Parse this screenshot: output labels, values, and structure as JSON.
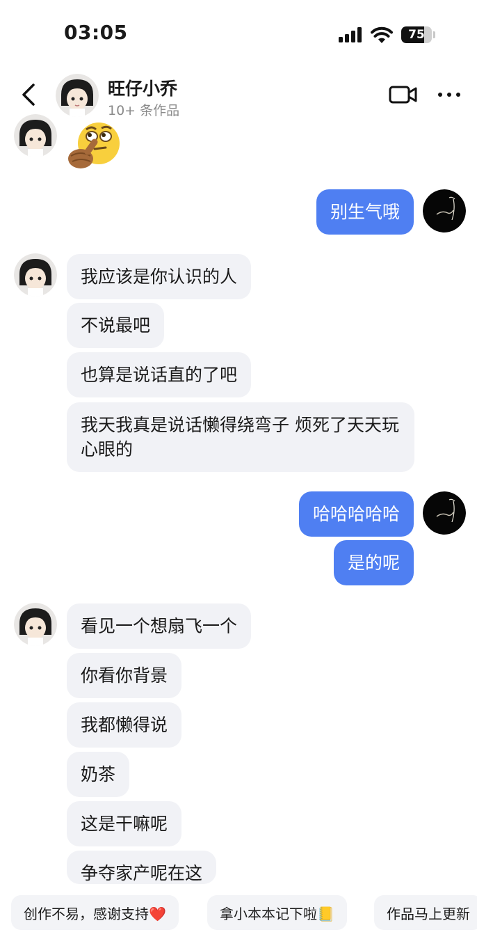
{
  "status_bar": {
    "time": "03:05",
    "battery": "75",
    "battery_level": 0.75
  },
  "header": {
    "title": "旺仔小乔",
    "subtitle": "10+ 条作品"
  },
  "messages": {
    "out_1": "别生气哦",
    "in_1": "我应该是你认识的人",
    "in_2": "不说最吧",
    "in_3": "也算是说话直的了吧",
    "in_4": "我天我真是说话懒得绕弯子 烦死了天天玩心眼的",
    "out_2": "哈哈哈哈哈",
    "out_3": "是的呢",
    "in_5": "看见一个想扇飞一个",
    "in_6": "你看你背景",
    "in_7": "我都懒得说",
    "in_8": "奶茶",
    "in_9": "这是干嘛呢",
    "in_10": "争夺家产呢在这"
  },
  "quick_replies": [
    "创作不易，感谢支持❤️",
    "拿小本本记下啦📒",
    "作品马上更新"
  ],
  "colors": {
    "outgoing_bubble": "#4f7ff2",
    "incoming_bubble": "#f1f2f6",
    "chip_background": "#f3f4f7"
  },
  "icons": {
    "back": "chevron-left-icon",
    "video": "video-camera-icon",
    "more": "more-dots-icon",
    "signal": "signal-icon",
    "wifi": "wifi-icon",
    "battery": "battery-icon"
  }
}
